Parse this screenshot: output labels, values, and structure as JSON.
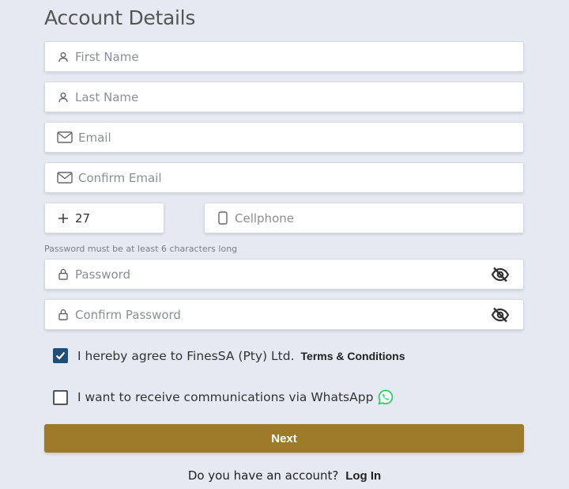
{
  "header": {
    "title": "Account Details"
  },
  "fields": {
    "first_name": {
      "placeholder": "First Name",
      "icon": "user-icon"
    },
    "last_name": {
      "placeholder": "Last Name",
      "icon": "user-icon"
    },
    "email": {
      "placeholder": "Email",
      "icon": "mail-icon"
    },
    "confirm_email": {
      "placeholder": "Confirm Email",
      "icon": "mail-icon"
    },
    "country_code": {
      "value": "27",
      "icon": "plus-icon"
    },
    "cellphone": {
      "placeholder": "Cellphone",
      "icon": "phone-icon"
    },
    "password_hint": "Password must be at least 6 characters long",
    "password": {
      "placeholder": "Password",
      "icon": "lock-icon",
      "toggle_icon": "eye-off-icon"
    },
    "confirm_password": {
      "placeholder": "Confirm Password",
      "icon": "lock-icon",
      "toggle_icon": "eye-off-icon"
    }
  },
  "agreements": {
    "terms": {
      "label": "I hereby agree to FinesSA (Pty) Ltd.",
      "link": "Terms & Conditions",
      "checked": true
    },
    "whatsapp": {
      "label": "I want to receive communications via WhatsApp",
      "checked": false,
      "icon": "whatsapp-icon"
    }
  },
  "actions": {
    "next_label": "Next"
  },
  "footer": {
    "prompt": "Do you have an account?",
    "login_label": "Log In"
  },
  "colors": {
    "background": "#e5eaf2",
    "accent": "#9c7a2a",
    "checkbox": "#1f4e79",
    "whatsapp": "#25d366"
  }
}
